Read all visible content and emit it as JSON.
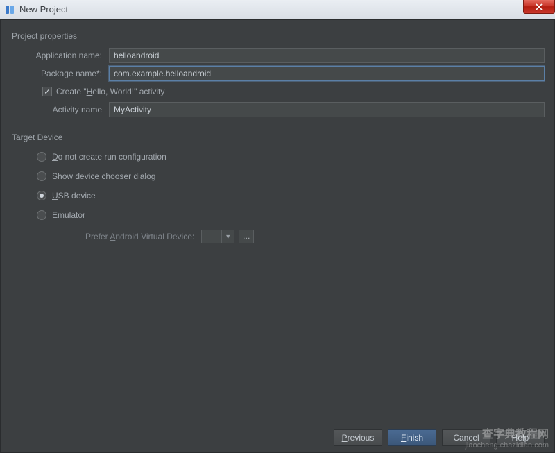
{
  "window": {
    "title": "New Project"
  },
  "project_properties": {
    "section_title": "Project properties",
    "app_name_label": "Application name:",
    "app_name_value": "helloandroid",
    "package_name_label": "Package name*:",
    "package_name_value": "com.example.helloandroid",
    "create_hello_world_checked": true,
    "create_hello_world_label_part1": "Create \"",
    "create_hello_world_hotkey": "H",
    "create_hello_world_label_part2": "ello, World!\" activity",
    "activity_name_label": "Activity name",
    "activity_name_value": "MyActivity"
  },
  "target_device": {
    "section_title": "Target Device",
    "options": [
      {
        "hotkey": "D",
        "rest": "o not create run configuration",
        "selected": false
      },
      {
        "hotkey": "S",
        "rest": "how device chooser dialog",
        "selected": false
      },
      {
        "hotkey": "U",
        "rest": "SB device",
        "selected": true
      },
      {
        "hotkey": "E",
        "rest": "mulator",
        "selected": false
      }
    ],
    "avd_label_pre": "Prefer ",
    "avd_label_hotkey": "A",
    "avd_label_post": "ndroid Virtual Device:"
  },
  "buttons": {
    "previous_hotkey": "P",
    "previous_rest": "revious",
    "finish_hotkey": "F",
    "finish_rest": "inish",
    "cancel": "Cancel",
    "help": "Help"
  },
  "watermark": {
    "line1": "查字典教程网",
    "line2": "jiaocheng.chazidian.com"
  }
}
